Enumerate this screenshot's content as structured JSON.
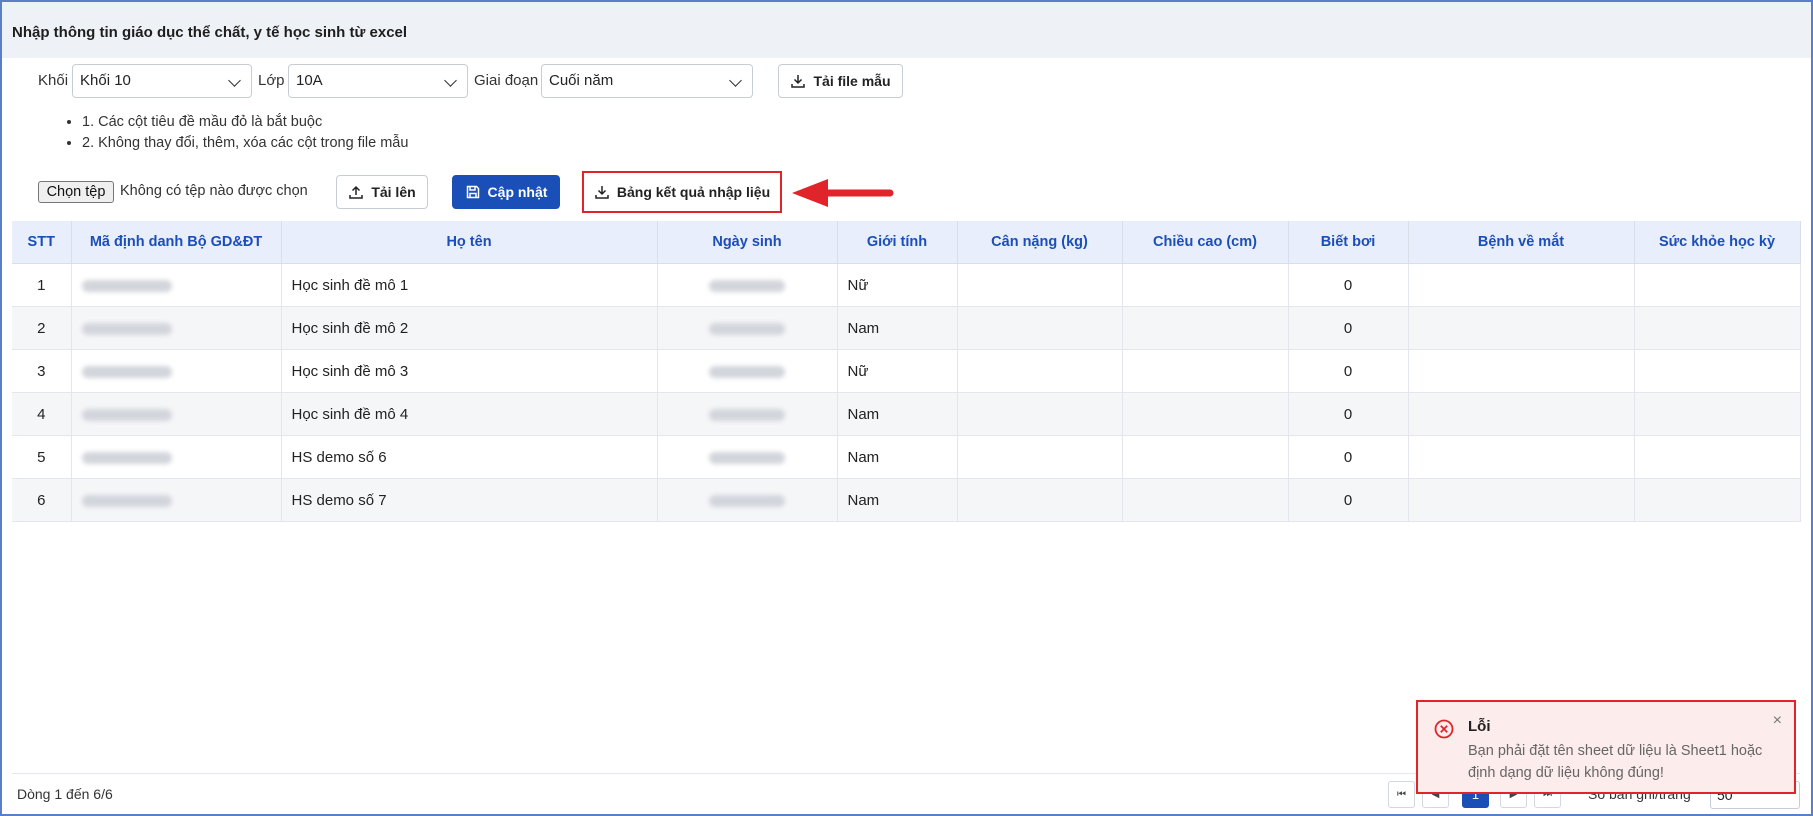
{
  "page": {
    "title": "Nhập thông tin giáo dục thể chất, y tế học sinh từ excel"
  },
  "filters": {
    "khoi_label": "Khối",
    "khoi_value": "Khối 10",
    "lop_label": "Lớp",
    "lop_value": "10A",
    "giaidoan_label": "Giai đoạn",
    "giaidoan_value": "Cuối năm",
    "download_template_label": "Tải file mẫu"
  },
  "notes": [
    "1. Các cột tiêu đề mầu đỏ là bắt buộc",
    "2. Không thay đổi, thêm, xóa các cột trong file mẫu"
  ],
  "actions": {
    "choose_file_label": "Chọn tệp",
    "no_file_text": "Không có tệp nào được chọn",
    "upload_label": "Tải lên",
    "update_label": "Cập nhật",
    "result_table_label": "Bảng kết quả nhập liệu"
  },
  "table": {
    "columns": [
      "STT",
      "Mã định danh Bộ GD&ĐT",
      "Họ tên",
      "Ngày sinh",
      "Giới tính",
      "Cân nặng (kg)",
      "Chiều cao (cm)",
      "Biết bơi",
      "Bệnh về mắt",
      "Sức khỏe học kỳ"
    ],
    "rows": [
      {
        "stt": "1",
        "ho_ten": "Học sinh đề mô 1",
        "gioi_tinh": "Nữ",
        "can_nang": "",
        "chieu_cao": "",
        "biet_boi": "0",
        "benh_mat": "",
        "suc_khoe": ""
      },
      {
        "stt": "2",
        "ho_ten": "Học sinh đề mô 2",
        "gioi_tinh": "Nam",
        "can_nang": "",
        "chieu_cao": "",
        "biet_boi": "0",
        "benh_mat": "",
        "suc_khoe": ""
      },
      {
        "stt": "3",
        "ho_ten": "Học sinh đề mô 3",
        "gioi_tinh": "Nữ",
        "can_nang": "",
        "chieu_cao": "",
        "biet_boi": "0",
        "benh_mat": "",
        "suc_khoe": ""
      },
      {
        "stt": "4",
        "ho_ten": "Học sinh đề mô 4",
        "gioi_tinh": "Nam",
        "can_nang": "",
        "chieu_cao": "",
        "biet_boi": "0",
        "benh_mat": "",
        "suc_khoe": ""
      },
      {
        "stt": "5",
        "ho_ten": "HS demo số 6",
        "gioi_tinh": "Nam",
        "can_nang": "",
        "chieu_cao": "",
        "biet_boi": "0",
        "benh_mat": "",
        "suc_khoe": ""
      },
      {
        "stt": "6",
        "ho_ten": "HS demo số 7",
        "gioi_tinh": "Nam",
        "can_nang": "",
        "chieu_cao": "",
        "biet_boi": "0",
        "benh_mat": "",
        "suc_khoe": ""
      }
    ]
  },
  "footer": {
    "row_count": "Dòng 1 đến 6/6",
    "current_page": "1",
    "page_size_label": "Số bản ghi/trang",
    "page_size_value": "50"
  },
  "toast": {
    "title": "Lỗi",
    "message": "Bạn phải đặt tên sheet dữ liệu là Sheet1 hoặc định dạng dữ liệu không đúng!",
    "close": "×"
  },
  "colors": {
    "primary": "#1b4fb8",
    "header_bg": "#e8eefb",
    "highlight": "#e0242a",
    "toast_bg": "#fcecec"
  },
  "icons": [
    "download-icon",
    "upload-icon",
    "save-icon",
    "chevron-down-icon",
    "error-icon",
    "close-icon",
    "arrow-annotation"
  ]
}
